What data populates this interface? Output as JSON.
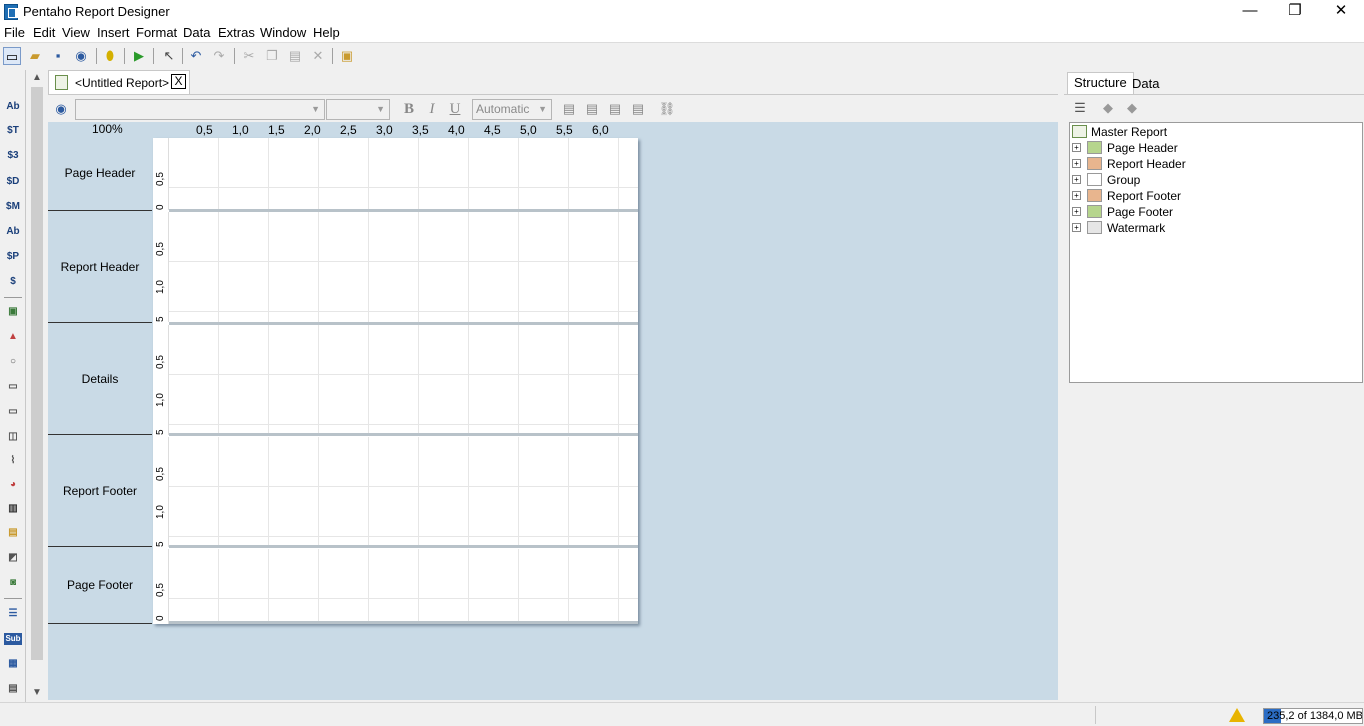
{
  "window": {
    "title": "Pentaho Report Designer",
    "minimize": "—",
    "maximize": "❐",
    "close": "✕"
  },
  "menu": [
    "File",
    "Edit",
    "View",
    "Insert",
    "Format",
    "Data",
    "Extras",
    "Window",
    "Help"
  ],
  "document_tab": {
    "label": "<Untitled Report>",
    "close": "X"
  },
  "format_bar": {
    "font_combo": "",
    "size_combo": "",
    "bold": "B",
    "italic": "I",
    "underline": "U",
    "color_combo": "Automatic"
  },
  "zoom": "100%",
  "ruler_h": [
    "0,5",
    "1,0",
    "1,5",
    "2,0",
    "2,5",
    "3,0",
    "3,5",
    "4,0",
    "4,5",
    "5,0",
    "5,5",
    "6,0"
  ],
  "bands": [
    {
      "label": "Page Header",
      "ticks": [
        "0,5",
        "0"
      ]
    },
    {
      "label": "Report Header",
      "ticks": [
        "0,5",
        "1,0",
        "5"
      ]
    },
    {
      "label": "Details",
      "ticks": [
        "0,5",
        "1,0",
        "5"
      ]
    },
    {
      "label": "Report Footer",
      "ticks": [
        "0,5",
        "1,0",
        "5"
      ]
    },
    {
      "label": "Page Footer",
      "ticks": [
        "0,5",
        "0"
      ]
    }
  ],
  "palette_labels": [
    "Ab",
    "$T",
    "$3",
    "$D",
    "$M",
    "Ab",
    "$P",
    "$"
  ],
  "palette_extra": [
    "Sub"
  ],
  "right_panel": {
    "tabs": [
      "Structure",
      "Data"
    ],
    "tree_root": "Master Report",
    "tree_items": [
      "Page Header",
      "Report Header",
      "Group",
      "Report Footer",
      "Page Footer",
      "Watermark"
    ],
    "tree_colors": [
      "#b6d58d",
      "#e8b58e",
      "#ffffff",
      "#e8b58e",
      "#b6d58d",
      "#e6e6e6"
    ]
  },
  "status": {
    "memory": "235,2 of 1384,0 MB",
    "memory_fraction": 0.17
  }
}
